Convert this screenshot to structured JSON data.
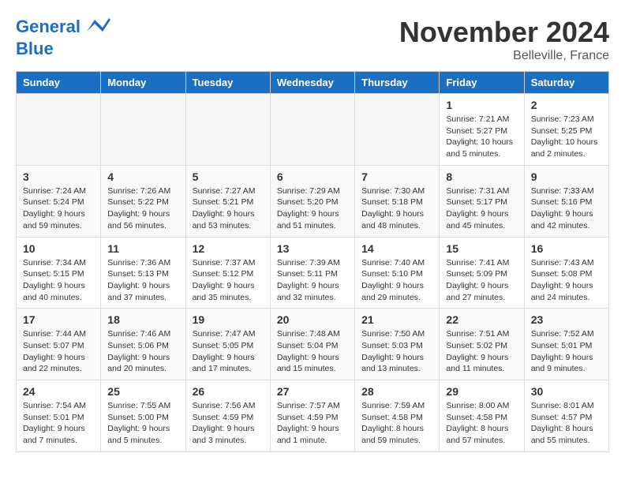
{
  "logo": {
    "line1": "General",
    "line2": "Blue"
  },
  "title": "November 2024",
  "location": "Belleville, France",
  "days_of_week": [
    "Sunday",
    "Monday",
    "Tuesday",
    "Wednesday",
    "Thursday",
    "Friday",
    "Saturday"
  ],
  "weeks": [
    [
      {
        "day": "",
        "info": ""
      },
      {
        "day": "",
        "info": ""
      },
      {
        "day": "",
        "info": ""
      },
      {
        "day": "",
        "info": ""
      },
      {
        "day": "",
        "info": ""
      },
      {
        "day": "1",
        "info": "Sunrise: 7:21 AM\nSunset: 5:27 PM\nDaylight: 10 hours\nand 5 minutes."
      },
      {
        "day": "2",
        "info": "Sunrise: 7:23 AM\nSunset: 5:25 PM\nDaylight: 10 hours\nand 2 minutes."
      }
    ],
    [
      {
        "day": "3",
        "info": "Sunrise: 7:24 AM\nSunset: 5:24 PM\nDaylight: 9 hours\nand 59 minutes."
      },
      {
        "day": "4",
        "info": "Sunrise: 7:26 AM\nSunset: 5:22 PM\nDaylight: 9 hours\nand 56 minutes."
      },
      {
        "day": "5",
        "info": "Sunrise: 7:27 AM\nSunset: 5:21 PM\nDaylight: 9 hours\nand 53 minutes."
      },
      {
        "day": "6",
        "info": "Sunrise: 7:29 AM\nSunset: 5:20 PM\nDaylight: 9 hours\nand 51 minutes."
      },
      {
        "day": "7",
        "info": "Sunrise: 7:30 AM\nSunset: 5:18 PM\nDaylight: 9 hours\nand 48 minutes."
      },
      {
        "day": "8",
        "info": "Sunrise: 7:31 AM\nSunset: 5:17 PM\nDaylight: 9 hours\nand 45 minutes."
      },
      {
        "day": "9",
        "info": "Sunrise: 7:33 AM\nSunset: 5:16 PM\nDaylight: 9 hours\nand 42 minutes."
      }
    ],
    [
      {
        "day": "10",
        "info": "Sunrise: 7:34 AM\nSunset: 5:15 PM\nDaylight: 9 hours\nand 40 minutes."
      },
      {
        "day": "11",
        "info": "Sunrise: 7:36 AM\nSunset: 5:13 PM\nDaylight: 9 hours\nand 37 minutes."
      },
      {
        "day": "12",
        "info": "Sunrise: 7:37 AM\nSunset: 5:12 PM\nDaylight: 9 hours\nand 35 minutes."
      },
      {
        "day": "13",
        "info": "Sunrise: 7:39 AM\nSunset: 5:11 PM\nDaylight: 9 hours\nand 32 minutes."
      },
      {
        "day": "14",
        "info": "Sunrise: 7:40 AM\nSunset: 5:10 PM\nDaylight: 9 hours\nand 29 minutes."
      },
      {
        "day": "15",
        "info": "Sunrise: 7:41 AM\nSunset: 5:09 PM\nDaylight: 9 hours\nand 27 minutes."
      },
      {
        "day": "16",
        "info": "Sunrise: 7:43 AM\nSunset: 5:08 PM\nDaylight: 9 hours\nand 24 minutes."
      }
    ],
    [
      {
        "day": "17",
        "info": "Sunrise: 7:44 AM\nSunset: 5:07 PM\nDaylight: 9 hours\nand 22 minutes."
      },
      {
        "day": "18",
        "info": "Sunrise: 7:46 AM\nSunset: 5:06 PM\nDaylight: 9 hours\nand 20 minutes."
      },
      {
        "day": "19",
        "info": "Sunrise: 7:47 AM\nSunset: 5:05 PM\nDaylight: 9 hours\nand 17 minutes."
      },
      {
        "day": "20",
        "info": "Sunrise: 7:48 AM\nSunset: 5:04 PM\nDaylight: 9 hours\nand 15 minutes."
      },
      {
        "day": "21",
        "info": "Sunrise: 7:50 AM\nSunset: 5:03 PM\nDaylight: 9 hours\nand 13 minutes."
      },
      {
        "day": "22",
        "info": "Sunrise: 7:51 AM\nSunset: 5:02 PM\nDaylight: 9 hours\nand 11 minutes."
      },
      {
        "day": "23",
        "info": "Sunrise: 7:52 AM\nSunset: 5:01 PM\nDaylight: 9 hours\nand 9 minutes."
      }
    ],
    [
      {
        "day": "24",
        "info": "Sunrise: 7:54 AM\nSunset: 5:01 PM\nDaylight: 9 hours\nand 7 minutes."
      },
      {
        "day": "25",
        "info": "Sunrise: 7:55 AM\nSunset: 5:00 PM\nDaylight: 9 hours\nand 5 minutes."
      },
      {
        "day": "26",
        "info": "Sunrise: 7:56 AM\nSunset: 4:59 PM\nDaylight: 9 hours\nand 3 minutes."
      },
      {
        "day": "27",
        "info": "Sunrise: 7:57 AM\nSunset: 4:59 PM\nDaylight: 9 hours\nand 1 minute."
      },
      {
        "day": "28",
        "info": "Sunrise: 7:59 AM\nSunset: 4:58 PM\nDaylight: 8 hours\nand 59 minutes."
      },
      {
        "day": "29",
        "info": "Sunrise: 8:00 AM\nSunset: 4:58 PM\nDaylight: 8 hours\nand 57 minutes."
      },
      {
        "day": "30",
        "info": "Sunrise: 8:01 AM\nSunset: 4:57 PM\nDaylight: 8 hours\nand 55 minutes."
      }
    ]
  ]
}
